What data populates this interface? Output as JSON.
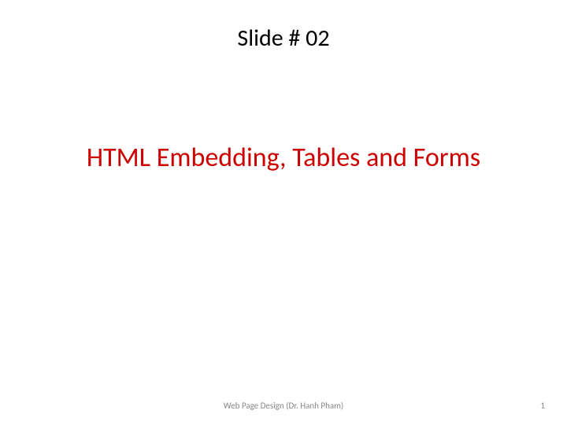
{
  "slide": {
    "number_label": "Slide # 02",
    "title": "HTML Embedding, Tables and Forms",
    "footer_text": "Web Page Design (Dr. Hanh Pham)",
    "page_number": "1"
  }
}
